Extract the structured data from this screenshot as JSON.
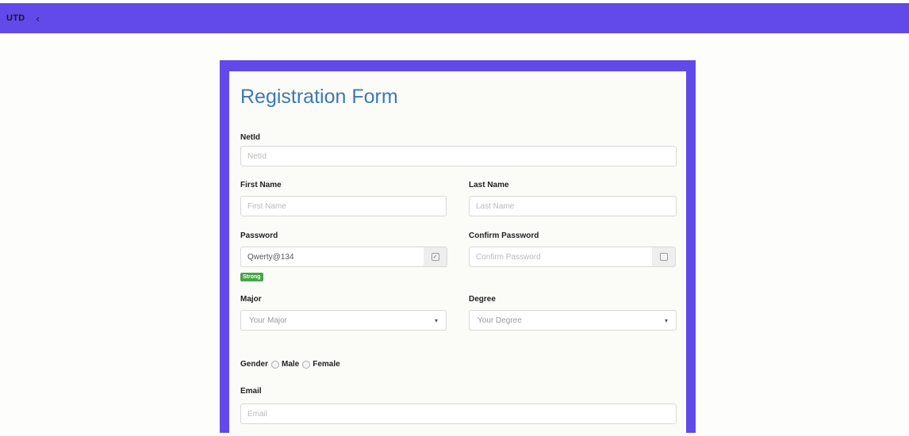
{
  "nav": {
    "brand": "UTD",
    "back_icon": "‹"
  },
  "form": {
    "title": "Registration Form",
    "netid": {
      "label": "NetId",
      "placeholder": "NetId"
    },
    "first_name": {
      "label": "First Name",
      "placeholder": "First Name"
    },
    "last_name": {
      "label": "Last Name",
      "placeholder": "Last Name"
    },
    "password": {
      "label": "Password",
      "value": "Qwerty@134",
      "strength": "Strong"
    },
    "confirm_password": {
      "label": "Confirm Password",
      "placeholder": "Confirm Password"
    },
    "major": {
      "label": "Major",
      "selected": "Your Major"
    },
    "degree": {
      "label": "Degree",
      "selected": "Your Degree"
    },
    "gender": {
      "label": "Gender",
      "options": [
        "Male",
        "Female"
      ]
    },
    "email": {
      "label": "Email",
      "placeholder": "Email"
    }
  },
  "colors": {
    "accent": "#6149ea",
    "title": "#3e78b6",
    "strong_badge": "#46a54a"
  }
}
